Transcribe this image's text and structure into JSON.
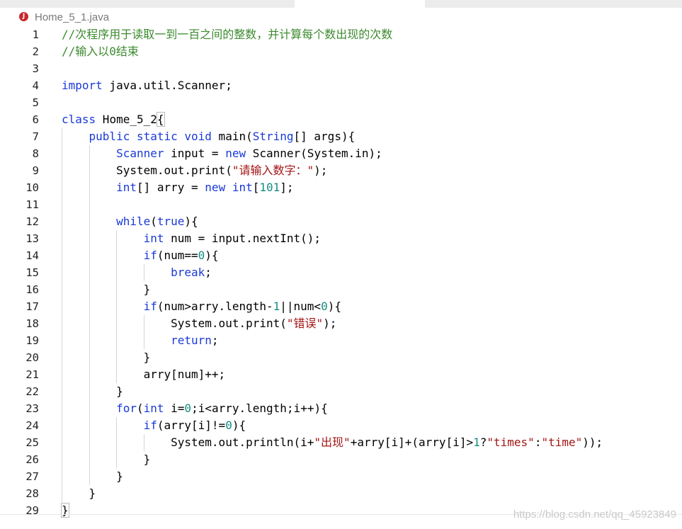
{
  "tab": {
    "title": "Home_5_1.java",
    "icon_letter": "J",
    "icon": "java-error-icon"
  },
  "colors": {
    "comment": "#3c8a2e",
    "keyword": "#1a39d6",
    "number": "#158c82",
    "string": "#a31515",
    "plain": "#000000",
    "line_number": "#222222"
  },
  "code_lines": [
    {
      "num": "1",
      "tokens": [
        {
          "t": "//次程序用于读取一到一百之间的整数，并计算每个数出现的次数",
          "c": "comment"
        }
      ]
    },
    {
      "num": "2",
      "tokens": [
        {
          "t": "//输入以0结束",
          "c": "comment"
        }
      ]
    },
    {
      "num": "3",
      "tokens": []
    },
    {
      "num": "4",
      "tokens": [
        {
          "t": "import",
          "c": "keyword"
        },
        {
          "t": " java.util.Scanner;",
          "c": "plain"
        }
      ]
    },
    {
      "num": "5",
      "tokens": []
    },
    {
      "num": "6",
      "tokens": [
        {
          "t": "class",
          "c": "keyword"
        },
        {
          "t": " Home_5_2",
          "c": "plain"
        },
        {
          "t": "{",
          "c": "plain"
        }
      ]
    },
    {
      "num": "7",
      "tokens": [
        {
          "t": "    ",
          "c": "plain"
        },
        {
          "t": "public static void",
          "c": "keyword"
        },
        {
          "t": " main(",
          "c": "plain"
        },
        {
          "t": "String",
          "c": "type"
        },
        {
          "t": "[] args){",
          "c": "plain"
        }
      ]
    },
    {
      "num": "8",
      "tokens": [
        {
          "t": "        ",
          "c": "plain"
        },
        {
          "t": "Scanner",
          "c": "type"
        },
        {
          "t": " input = ",
          "c": "plain"
        },
        {
          "t": "new",
          "c": "keyword"
        },
        {
          "t": " Scanner(System.in);",
          "c": "plain"
        }
      ]
    },
    {
      "num": "9",
      "tokens": [
        {
          "t": "        System.out.print(",
          "c": "plain"
        },
        {
          "t": "\"请输入数字：\"",
          "c": "string"
        },
        {
          "t": ");",
          "c": "plain"
        }
      ]
    },
    {
      "num": "10",
      "tokens": [
        {
          "t": "        ",
          "c": "plain"
        },
        {
          "t": "int",
          "c": "keyword"
        },
        {
          "t": "[] arry = ",
          "c": "plain"
        },
        {
          "t": "new",
          "c": "keyword"
        },
        {
          "t": " ",
          "c": "plain"
        },
        {
          "t": "int",
          "c": "keyword"
        },
        {
          "t": "[",
          "c": "plain"
        },
        {
          "t": "101",
          "c": "number"
        },
        {
          "t": "];",
          "c": "plain"
        }
      ]
    },
    {
      "num": "11",
      "tokens": []
    },
    {
      "num": "12",
      "tokens": [
        {
          "t": "        ",
          "c": "plain"
        },
        {
          "t": "while",
          "c": "keyword"
        },
        {
          "t": "(",
          "c": "plain"
        },
        {
          "t": "true",
          "c": "keyword"
        },
        {
          "t": "){",
          "c": "plain"
        }
      ]
    },
    {
      "num": "13",
      "tokens": [
        {
          "t": "            ",
          "c": "plain"
        },
        {
          "t": "int",
          "c": "keyword"
        },
        {
          "t": " num = input.nextInt();",
          "c": "plain"
        }
      ]
    },
    {
      "num": "14",
      "tokens": [
        {
          "t": "            ",
          "c": "plain"
        },
        {
          "t": "if",
          "c": "keyword"
        },
        {
          "t": "(num==",
          "c": "plain"
        },
        {
          "t": "0",
          "c": "number"
        },
        {
          "t": "){",
          "c": "plain"
        }
      ]
    },
    {
      "num": "15",
      "tokens": [
        {
          "t": "                ",
          "c": "plain"
        },
        {
          "t": "break",
          "c": "keyword"
        },
        {
          "t": ";",
          "c": "plain"
        }
      ]
    },
    {
      "num": "16",
      "tokens": [
        {
          "t": "            }",
          "c": "plain"
        }
      ]
    },
    {
      "num": "17",
      "tokens": [
        {
          "t": "            ",
          "c": "plain"
        },
        {
          "t": "if",
          "c": "keyword"
        },
        {
          "t": "(num>arry.length-",
          "c": "plain"
        },
        {
          "t": "1",
          "c": "number"
        },
        {
          "t": "||num<",
          "c": "plain"
        },
        {
          "t": "0",
          "c": "number"
        },
        {
          "t": "){",
          "c": "plain"
        }
      ]
    },
    {
      "num": "18",
      "tokens": [
        {
          "t": "                System.out.print(",
          "c": "plain"
        },
        {
          "t": "\"错误\"",
          "c": "string"
        },
        {
          "t": ");",
          "c": "plain"
        }
      ]
    },
    {
      "num": "19",
      "tokens": [
        {
          "t": "                ",
          "c": "plain"
        },
        {
          "t": "return",
          "c": "keyword"
        },
        {
          "t": ";",
          "c": "plain"
        }
      ]
    },
    {
      "num": "20",
      "tokens": [
        {
          "t": "            }",
          "c": "plain"
        }
      ]
    },
    {
      "num": "21",
      "tokens": [
        {
          "t": "            arry[num]++;",
          "c": "plain"
        }
      ]
    },
    {
      "num": "22",
      "tokens": [
        {
          "t": "        }",
          "c": "plain"
        }
      ]
    },
    {
      "num": "23",
      "tokens": [
        {
          "t": "        ",
          "c": "plain"
        },
        {
          "t": "for",
          "c": "keyword"
        },
        {
          "t": "(",
          "c": "plain"
        },
        {
          "t": "int",
          "c": "keyword"
        },
        {
          "t": " i=",
          "c": "plain"
        },
        {
          "t": "0",
          "c": "number"
        },
        {
          "t": ";i<arry.length;i++){",
          "c": "plain"
        }
      ]
    },
    {
      "num": "24",
      "tokens": [
        {
          "t": "            ",
          "c": "plain"
        },
        {
          "t": "if",
          "c": "keyword"
        },
        {
          "t": "(arry[i]!=",
          "c": "plain"
        },
        {
          "t": "0",
          "c": "number"
        },
        {
          "t": "){",
          "c": "plain"
        }
      ]
    },
    {
      "num": "25",
      "tokens": [
        {
          "t": "                System.out.println(i+",
          "c": "plain"
        },
        {
          "t": "\"出现\"",
          "c": "string"
        },
        {
          "t": "+arry[i]+(arry[i]>",
          "c": "plain"
        },
        {
          "t": "1",
          "c": "number"
        },
        {
          "t": "?",
          "c": "plain"
        },
        {
          "t": "\"times\"",
          "c": "string"
        },
        {
          "t": ":",
          "c": "plain"
        },
        {
          "t": "\"time\"",
          "c": "string"
        },
        {
          "t": "));",
          "c": "plain"
        }
      ]
    },
    {
      "num": "26",
      "tokens": [
        {
          "t": "            }",
          "c": "plain"
        }
      ]
    },
    {
      "num": "27",
      "tokens": [
        {
          "t": "        }",
          "c": "plain"
        }
      ]
    },
    {
      "num": "28",
      "tokens": [
        {
          "t": "    }",
          "c": "plain"
        }
      ]
    },
    {
      "num": "29",
      "tokens": [
        {
          "t": "}",
          "c": "plain"
        }
      ]
    }
  ],
  "watermark": "https://blog.csdn.net/qq_45923849"
}
